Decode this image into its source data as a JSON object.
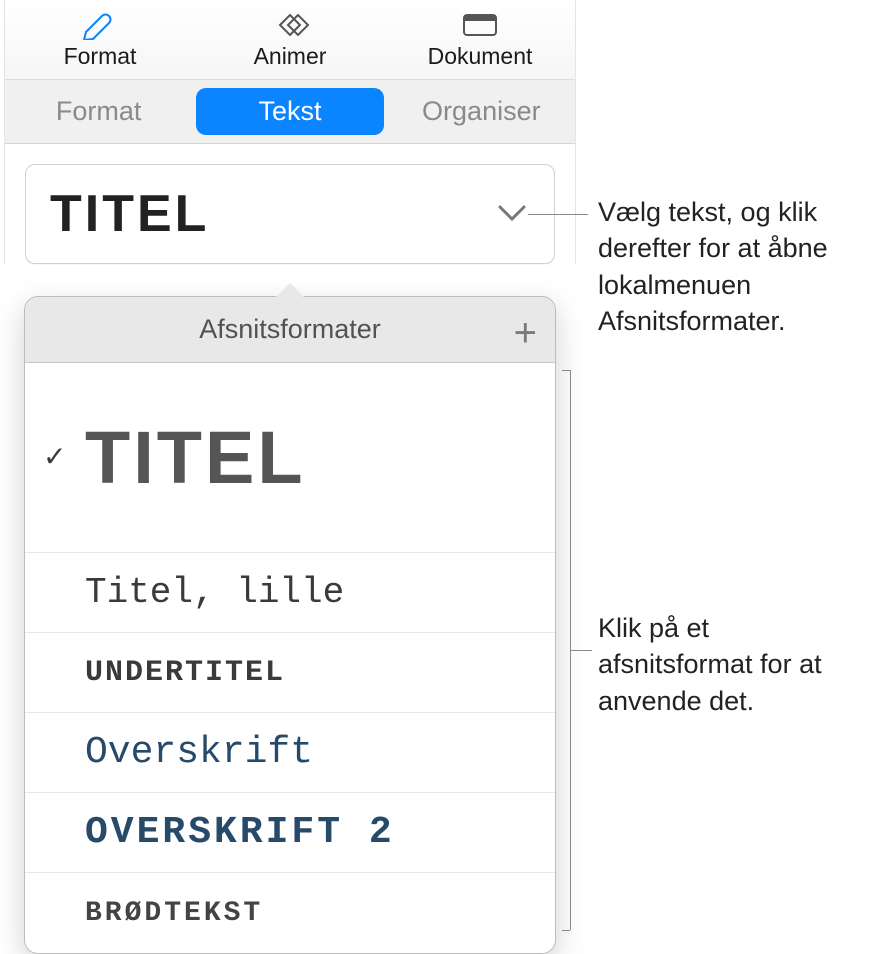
{
  "toolbar": {
    "format": "Format",
    "animate": "Animer",
    "document": "Dokument"
  },
  "subtabs": {
    "format": "Format",
    "text": "Tekst",
    "organize": "Organiser"
  },
  "dropdown": {
    "current_style": "TITEL"
  },
  "popover": {
    "header": "Afsnitsformater",
    "items": [
      {
        "label": "TITEL",
        "css": "style-titel",
        "checked": true
      },
      {
        "label": "Titel, lille",
        "css": "style-titel-lille",
        "checked": false
      },
      {
        "label": "UNDERTITEL",
        "css": "style-undertitel",
        "checked": false
      },
      {
        "label": "Overskrift",
        "css": "style-overskrift",
        "checked": false
      },
      {
        "label": "OVERSKRIFT 2",
        "css": "style-overskrift2",
        "checked": false
      },
      {
        "label": "BRØDTEKST",
        "css": "style-brodtekst",
        "checked": false
      }
    ]
  },
  "callouts": {
    "top": "Vælg tekst, og klik derefter for at åbne lokalmenuen Afsnitsformater.",
    "bottom": "Klik på et afsnitsformat for at anvende det."
  }
}
